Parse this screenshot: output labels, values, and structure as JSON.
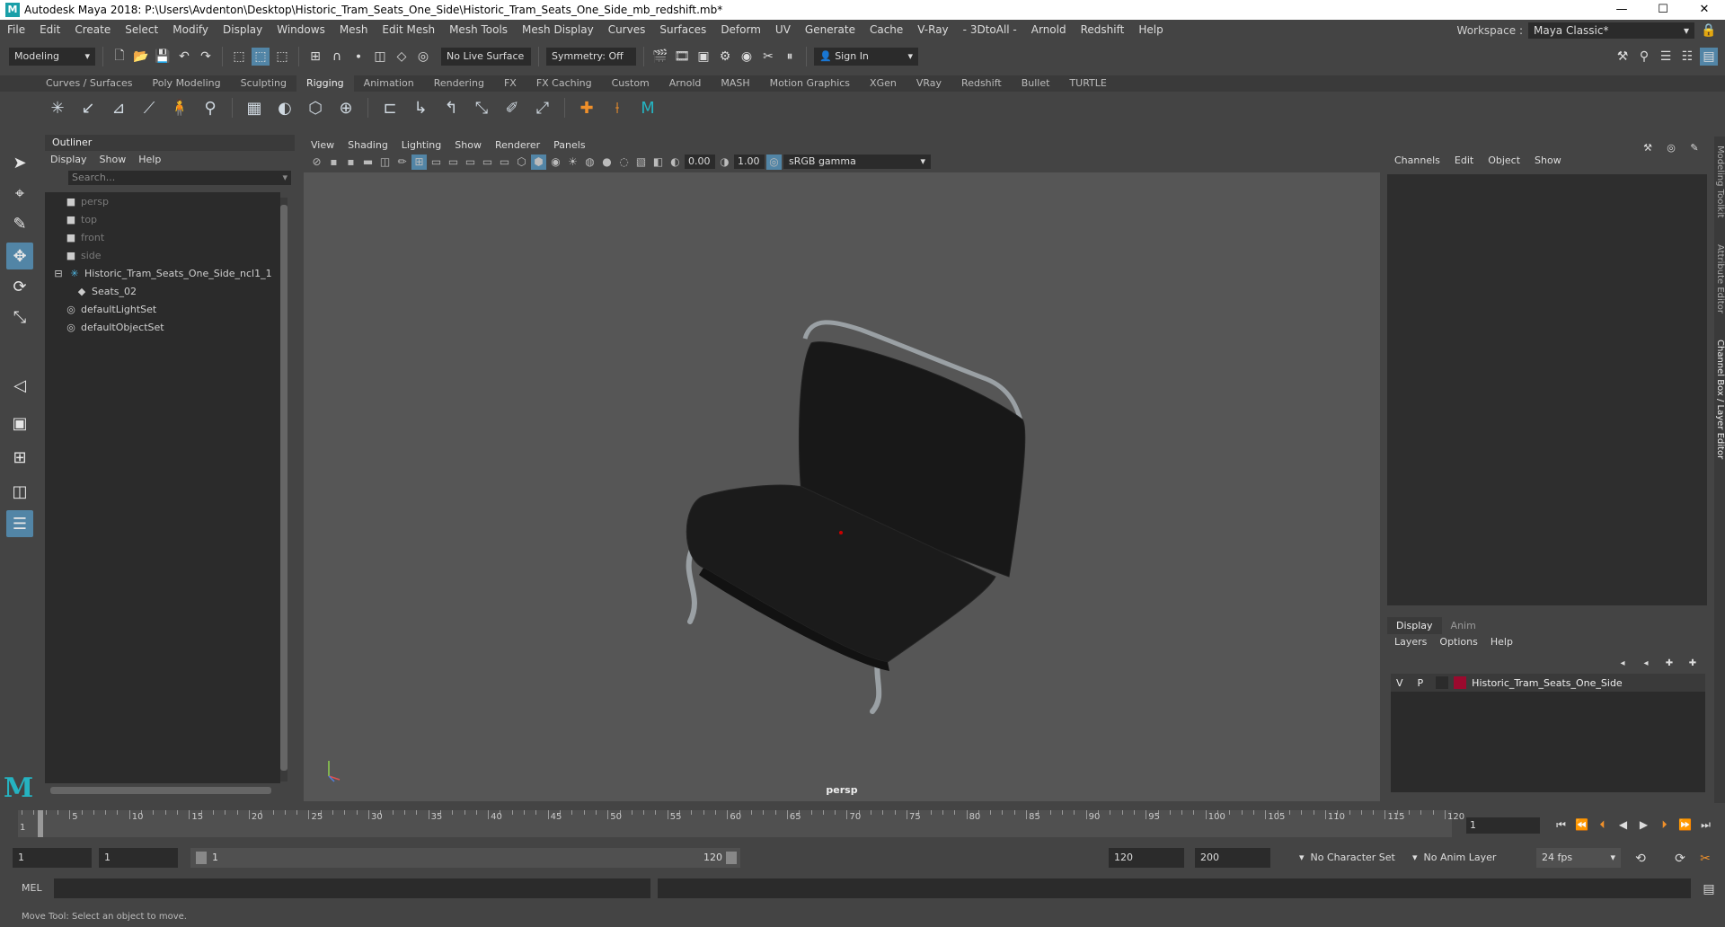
{
  "titlebar": {
    "title": "Autodesk Maya 2018: P:\\Users\\Avdenton\\Desktop\\Historic_Tram_Seats_One_Side\\Historic_Tram_Seats_One_Side_mb_redshift.mb*",
    "minimize": "—",
    "maximize": "☐",
    "close": "✕"
  },
  "menubar": {
    "items": [
      "File",
      "Edit",
      "Create",
      "Select",
      "Modify",
      "Display",
      "Windows",
      "Mesh",
      "Edit Mesh",
      "Mesh Tools",
      "Mesh Display",
      "Curves",
      "Surfaces",
      "Deform",
      "UV",
      "Generate",
      "Cache",
      "V-Ray",
      "- 3DtoAll -",
      "Arnold",
      "Redshift",
      "Help"
    ],
    "workspace_label": "Workspace :",
    "workspace_value": "Maya Classic*"
  },
  "statusline": {
    "mode": "Modeling",
    "live_surface": "No Live Surface",
    "symmetry": "Symmetry: Off",
    "sign_in": "Sign In"
  },
  "shelf": {
    "tabs": [
      "Curves / Surfaces",
      "Poly Modeling",
      "Sculpting",
      "Rigging",
      "Animation",
      "Rendering",
      "FX",
      "FX Caching",
      "Custom",
      "Arnold",
      "MASH",
      "Motion Graphics",
      "XGen",
      "VRay",
      "Redshift",
      "Bullet",
      "TURTLE"
    ],
    "active": "Rigging"
  },
  "outliner": {
    "title": "Outliner",
    "menu": [
      "Display",
      "Show",
      "Help"
    ],
    "search_placeholder": "Search...",
    "items": [
      {
        "label": "persp",
        "kind": "camera"
      },
      {
        "label": "top",
        "kind": "camera"
      },
      {
        "label": "front",
        "kind": "camera"
      },
      {
        "label": "side",
        "kind": "camera"
      },
      {
        "label": "Historic_Tram_Seats_One_Side_ncl1_1",
        "kind": "group"
      },
      {
        "label": "Seats_02",
        "kind": "mesh"
      },
      {
        "label": "defaultLightSet",
        "kind": "set"
      },
      {
        "label": "defaultObjectSet",
        "kind": "set"
      }
    ]
  },
  "viewport": {
    "menu": [
      "View",
      "Shading",
      "Lighting",
      "Show",
      "Renderer",
      "Panels"
    ],
    "exposure": "0.00",
    "gamma": "1.00",
    "color_space": "sRGB gamma",
    "camera": "persp"
  },
  "channelbox": {
    "menu": [
      "Channels",
      "Edit",
      "Object",
      "Show"
    ],
    "tabs": [
      "Display",
      "Anim"
    ],
    "active_tab": "Display",
    "layer_menu": [
      "Layers",
      "Options",
      "Help"
    ],
    "layer": {
      "v": "V",
      "p": "P",
      "name": "Historic_Tram_Seats_One_Side",
      "color": "#9b0a2e"
    }
  },
  "sidetabs": [
    "Modeling Toolkit",
    "Attribute Editor",
    "Channel Box / Layer Editor"
  ],
  "timeline": {
    "start": 1,
    "end": 120,
    "ticks": [
      "5",
      "10",
      "15",
      "20",
      "25",
      "30",
      "35",
      "40",
      "45",
      "50",
      "55",
      "60",
      "65",
      "70",
      "75",
      "80",
      "85",
      "90",
      "95",
      "100",
      "105",
      "110",
      "115",
      "120"
    ],
    "start_label": "1",
    "current_frame": "1"
  },
  "range": {
    "start": "1",
    "playback_start": "1",
    "range_start": "1",
    "range_end": "120",
    "end": "120",
    "anim_end": "200",
    "char_set": "No Character Set",
    "anim_layer": "No Anim Layer",
    "fps": "24 fps"
  },
  "cmdline": {
    "label": "MEL"
  },
  "helpline": {
    "text": "Move Tool: Select an object to move."
  }
}
